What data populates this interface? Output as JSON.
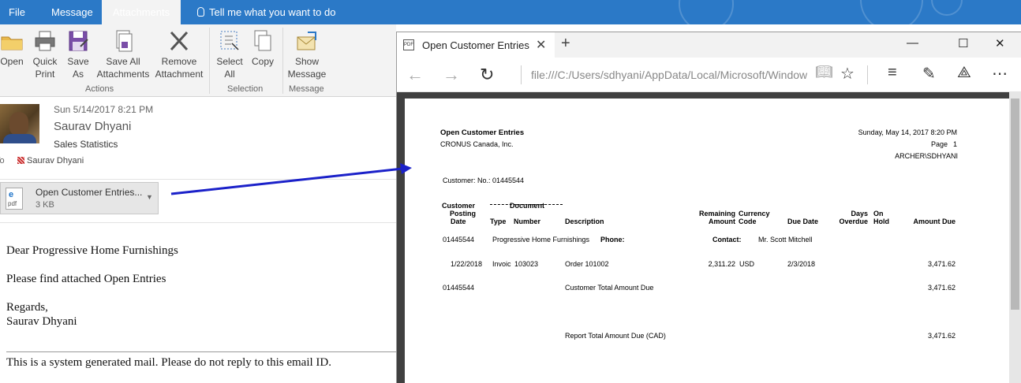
{
  "outlook": {
    "tabs": [
      "File",
      "Message",
      "Attachments",
      "Tell me what you want to do"
    ],
    "ribbon": {
      "open": "Open",
      "quick_print": [
        "Quick",
        "Print"
      ],
      "save_as": [
        "Save",
        "As"
      ],
      "save_all": [
        "Save All",
        "Attachments"
      ],
      "remove": [
        "Remove",
        "Attachment"
      ],
      "actions_group": "Actions",
      "select_all": [
        "Select",
        "All"
      ],
      "copy": "Copy",
      "selection_group": "Selection",
      "show_message": [
        "Show",
        "Message"
      ],
      "message_group": "Message"
    },
    "email": {
      "date": "Sun 5/14/2017 8:21 PM",
      "sender": "Saurav Dhyani",
      "subject": "Sales Statistics",
      "to_label": "To",
      "recipient": "Saurav Dhyani",
      "attachment_name": "Open Customer Entries...",
      "attachment_size": "3 KB",
      "body": [
        "Dear Progressive Home Furnishings",
        "Please find attached Open Entries",
        "Regards,",
        "Saurav Dhyani"
      ],
      "footer": "This is a system generated mail. Please do not reply to this email ID."
    }
  },
  "edge": {
    "tab_title": "Open Customer Entries",
    "url": "file:///C:/Users/sdhyani/AppData/Local/Microsoft/Windows/"
  },
  "report": {
    "title": "Open Customer Entries",
    "company": "CRONUS Canada, Inc.",
    "datetime": "Sunday, May 14, 2017 8:20 PM",
    "page_label": "Page",
    "page_number": "1",
    "user": "ARCHER\\SDHYANI",
    "filter": "Customer: No.: 01445544",
    "headers": {
      "customer": "Customer",
      "posting": "Posting",
      "date": "Date",
      "document": "Document",
      "type": "Type",
      "number": "Number",
      "description": "Description",
      "remaining": "Remaining",
      "amount": "Amount",
      "currency": "Currency",
      "code": "Code",
      "due_date": "Due Date",
      "days": "Days",
      "overdue": "Overdue",
      "on": "On",
      "hold": "Hold",
      "amount_due": "Amount Due"
    },
    "customer_row": {
      "no": "01445544",
      "name": "Progressive Home Furnishings",
      "phone_label": "Phone:",
      "contact_label": "Contact:",
      "contact": "Mr. Scott Mitchell"
    },
    "entry": {
      "posting_date": "1/22/2018",
      "type": "Invoic",
      "number": "103023",
      "description": "Order 101002",
      "remaining": "2,311.22",
      "currency": "USD",
      "due_date": "2/3/2018",
      "amount_due": "3,471.62"
    },
    "customer_total": {
      "no": "01445544",
      "label": "Customer Total Amount Due",
      "amount": "3,471.62"
    },
    "report_total": {
      "label": "Report Total Amount Due (CAD)",
      "amount": "3,471.62"
    }
  }
}
